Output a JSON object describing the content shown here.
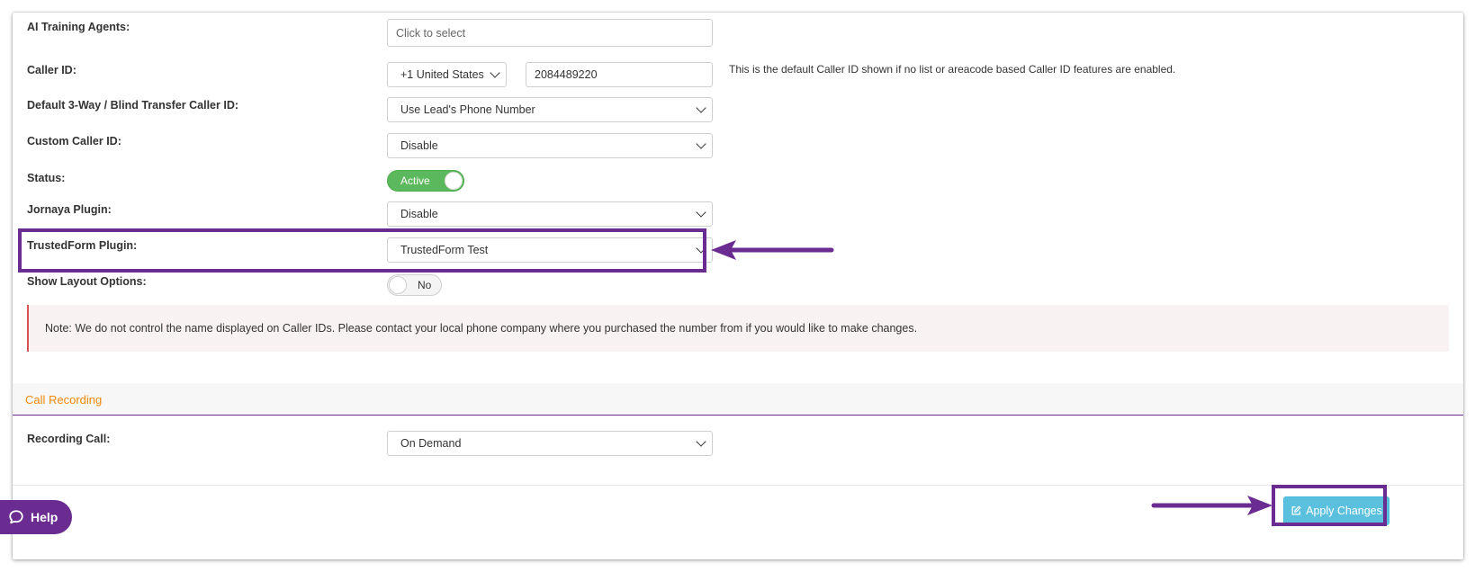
{
  "fields": {
    "ai_training_agents": {
      "label": "AI Training Agents:",
      "placeholder": "Click to select"
    },
    "caller_id": {
      "label": "Caller ID:",
      "country": "+1 United States",
      "number": "2084489220",
      "help": "This is the default Caller ID shown if no list or areacode based Caller ID features are enabled."
    },
    "transfer_caller_id": {
      "label": "Default 3-Way / Blind Transfer Caller ID:",
      "value": "Use Lead's Phone Number"
    },
    "custom_caller_id": {
      "label": "Custom Caller ID:",
      "value": "Disable"
    },
    "status": {
      "label": "Status:",
      "value": "Active",
      "on": true
    },
    "jornaya": {
      "label": "Jornaya Plugin:",
      "value": "Disable"
    },
    "trustedform": {
      "label": "TrustedForm Plugin:",
      "value": "TrustedForm Test"
    },
    "layout_options": {
      "label": "Show Layout Options:",
      "value": "No",
      "on": false
    }
  },
  "note": "Note: We do not control the name displayed on Caller IDs. Please contact your local phone company where you purchased the number from if you would like to make changes.",
  "call_recording": {
    "title": "Call Recording",
    "recording_call": {
      "label": "Recording Call:",
      "value": "On Demand"
    }
  },
  "footer": {
    "help_label": "Help",
    "apply_label": "Apply Changes"
  },
  "colors": {
    "accent": "#6a2c91",
    "success": "#5cb85c",
    "info": "#5bc0de",
    "section_title": "#f0880a",
    "note_border": "#d9534f"
  },
  "icons": {
    "help": "chat-bubble-icon",
    "apply": "edit-icon",
    "select": "chevron-down-icon"
  }
}
